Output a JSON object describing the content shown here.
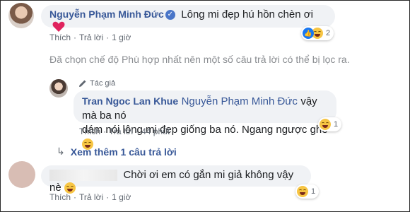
{
  "comment1": {
    "author": "Nguyễn Phạm Minh Đức",
    "text": "Lông mi đẹp hú hồn chèn ơi",
    "actions": {
      "like": "Thích",
      "reply": "Trả lời",
      "time": "1 giờ"
    },
    "reaction_count": "2"
  },
  "notice": "Đã chọn chế độ Phù hợp nhất nên một số câu trả lời có thể bị lọc ra.",
  "reply1": {
    "badge": "Tác giả",
    "author": "Tran Ngoc Lan Khue",
    "mention": "Nguyễn Phạm Minh Đức",
    "text_line1": "vậy mà ba nó",
    "text_line2": "dám nói lông mi đẹp giống ba nó. Ngang ngược ghê",
    "actions": {
      "like": "Thích",
      "reply": "Trả lời",
      "time": "44 phút"
    },
    "reaction_count": "1"
  },
  "more_replies": "Xem thêm 1 câu trả lời",
  "comment2": {
    "text": "Chời ơi em có gắn mi giả không vậy nè",
    "actions": {
      "like": "Thích",
      "reply": "Trả lời",
      "time": "1 giờ"
    },
    "reaction_count": "1"
  },
  "colors": {
    "link": "#385898",
    "bubble": "#f0f2f5",
    "heart": "#e0245e",
    "like": "#1877f2"
  }
}
